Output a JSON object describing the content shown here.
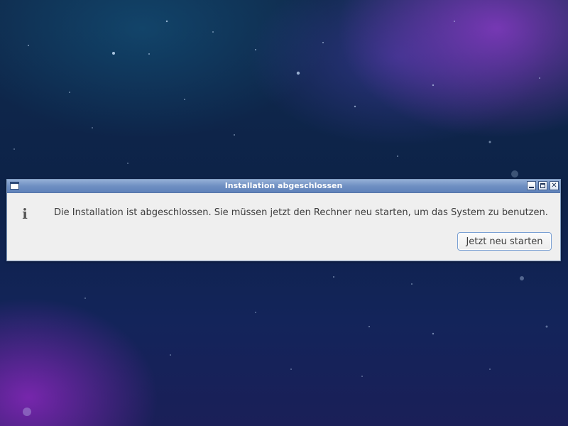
{
  "dialog": {
    "title": "Installation abgeschlossen",
    "message": "Die Installation ist abgeschlossen. Sie müssen jetzt den Rechner neu starten, um das System zu benutzen.",
    "info_icon_glyph": "i",
    "restart_button_label": "Jetzt neu starten"
  },
  "titlebar": {
    "close_glyph": "✕"
  },
  "colors": {
    "titlebar_accent": "#6f8fc2",
    "dialog_background": "#efefef",
    "button_border": "#7aa0d3"
  }
}
